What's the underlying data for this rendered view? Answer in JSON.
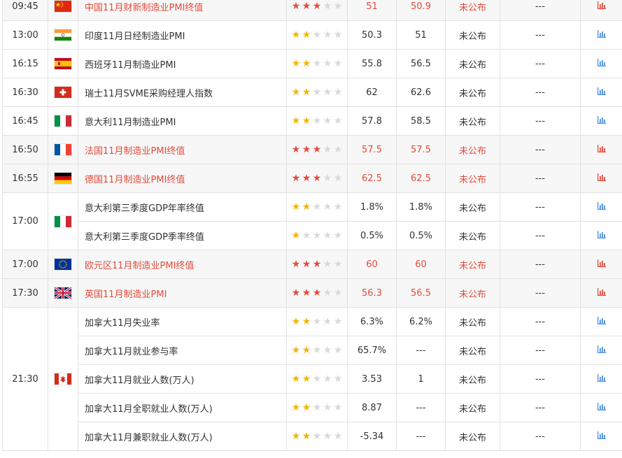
{
  "colors": {
    "highlight_text": "#e24b3b",
    "star_on": "#f5b400",
    "star_high": "#e24b3b",
    "star_off": "#d9d9d9",
    "chart_icon_blue": "#4a90e2",
    "chart_icon_red": "#e24b3b"
  },
  "rows": [
    {
      "time": "09:45",
      "flag": "cn",
      "event": "中国11月财新制造业PMI终值",
      "stars": 3,
      "prev": "51",
      "forecast": "50.9",
      "actual": "未公布",
      "extra": "---",
      "hl": true
    },
    {
      "time": "13:00",
      "flag": "in",
      "event": "印度11月日经制造业PMI",
      "stars": 2,
      "prev": "50.3",
      "forecast": "51",
      "actual": "未公布",
      "extra": "---",
      "hl": false
    },
    {
      "time": "16:15",
      "flag": "es",
      "event": "西班牙11月制造业PMI",
      "stars": 2,
      "prev": "55.8",
      "forecast": "56.5",
      "actual": "未公布",
      "extra": "---",
      "hl": false
    },
    {
      "time": "16:30",
      "flag": "ch",
      "event": "瑞士11月SVME采购经理人指数",
      "stars": 2,
      "prev": "62",
      "forecast": "62.6",
      "actual": "未公布",
      "extra": "---",
      "hl": false
    },
    {
      "time": "16:45",
      "flag": "it",
      "event": "意大利11月制造业PMI",
      "stars": 2,
      "prev": "57.8",
      "forecast": "58.5",
      "actual": "未公布",
      "extra": "---",
      "hl": false
    },
    {
      "time": "16:50",
      "flag": "fr",
      "event": "法国11月制造业PMI终值",
      "stars": 3,
      "prev": "57.5",
      "forecast": "57.5",
      "actual": "未公布",
      "extra": "---",
      "hl": true
    },
    {
      "time": "16:55",
      "flag": "de",
      "event": "德国11月制造业PMI终值",
      "stars": 3,
      "prev": "62.5",
      "forecast": "62.5",
      "actual": "未公布",
      "extra": "---",
      "hl": true
    },
    {
      "time": "17:00",
      "flag": "it",
      "span": 2,
      "event": "意大利第三季度GDP年率终值",
      "stars": 2,
      "prev": "1.8%",
      "forecast": "1.8%",
      "actual": "未公布",
      "extra": "---",
      "hl": false
    },
    {
      "event": "意大利第三季度GDP季率终值",
      "stars": 1,
      "prev": "0.5%",
      "forecast": "0.5%",
      "actual": "未公布",
      "extra": "---",
      "hl": false
    },
    {
      "time": "17:00",
      "flag": "eu",
      "event": "欧元区11月制造业PMI终值",
      "stars": 3,
      "prev": "60",
      "forecast": "60",
      "actual": "未公布",
      "extra": "---",
      "hl": true
    },
    {
      "time": "17:30",
      "flag": "gb",
      "event": "英国11月制造业PMI",
      "stars": 3,
      "prev": "56.3",
      "forecast": "56.5",
      "actual": "未公布",
      "extra": "---",
      "hl": true
    },
    {
      "time": "21:30",
      "flag": "ca",
      "span": 5,
      "event": "加拿大11月失业率",
      "stars": 2,
      "prev": "6.3%",
      "forecast": "6.2%",
      "actual": "未公布",
      "extra": "---",
      "hl": false
    },
    {
      "event": "加拿大11月就业参与率",
      "stars": 2,
      "prev": "65.7%",
      "forecast": "---",
      "actual": "未公布",
      "extra": "---",
      "hl": false
    },
    {
      "event": "加拿大11月就业人数(万人)",
      "stars": 2,
      "prev": "3.53",
      "forecast": "1",
      "actual": "未公布",
      "extra": "---",
      "hl": false
    },
    {
      "event": "加拿大11月全职就业人数(万人)",
      "stars": 2,
      "prev": "8.87",
      "forecast": "---",
      "actual": "未公布",
      "extra": "---",
      "hl": false
    },
    {
      "event": "加拿大11月兼职就业人数(万人)",
      "stars": 2,
      "prev": "-5.34",
      "forecast": "---",
      "actual": "未公布",
      "extra": "---",
      "hl": false
    }
  ]
}
